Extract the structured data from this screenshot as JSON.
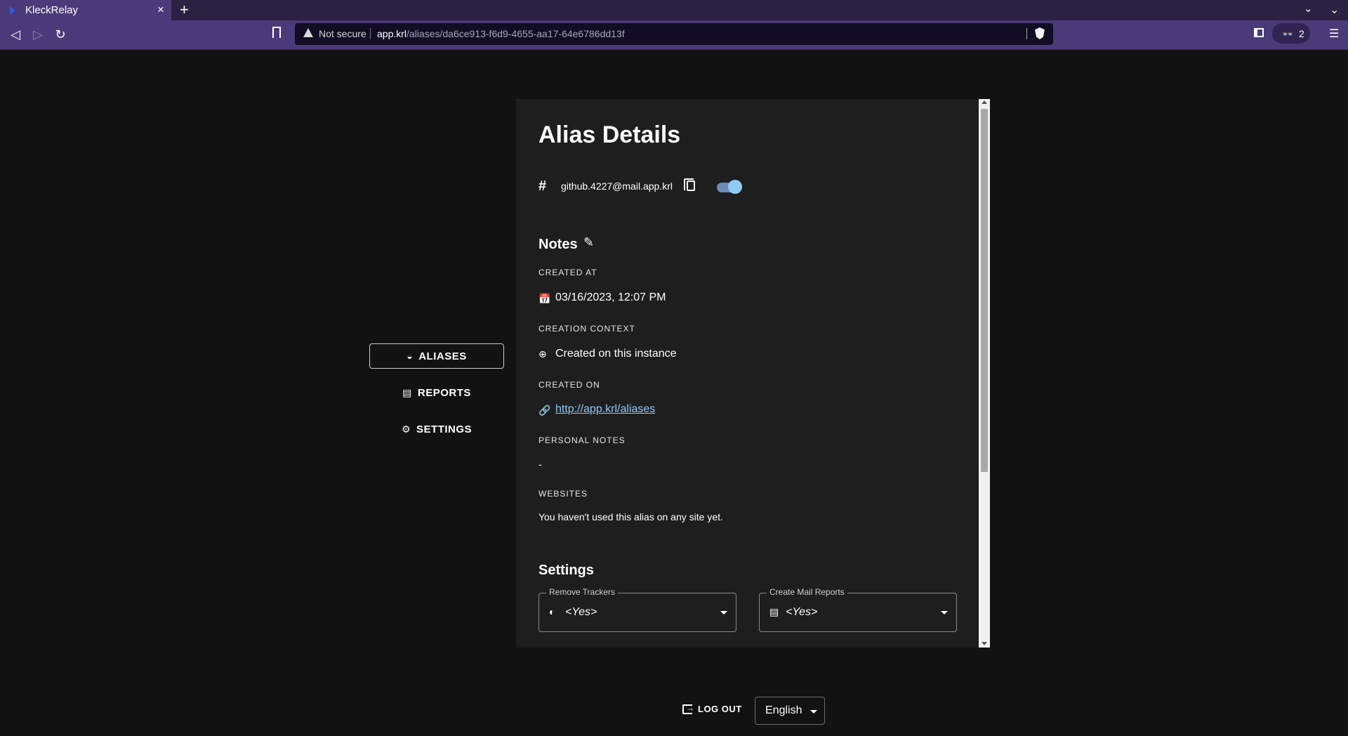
{
  "browser": {
    "tab_title": "KleckRelay",
    "tab_close": "×",
    "new_tab": "+",
    "tab_list": "⌄",
    "minimize": "⌄",
    "back": "◁",
    "forward": "▷",
    "reload": "↻",
    "not_secure": "Not secure",
    "url_host": "app.krl",
    "url_path": "/aliases/da6ce913-f6d9-4655-aa17-64e6786dd13f",
    "ext_icon": "👓",
    "ext_count": "2",
    "menu": "☰"
  },
  "sidebar": {
    "items": [
      {
        "label": "ALIASES",
        "icon": "mask-icon",
        "glyph": "◒",
        "active": true
      },
      {
        "label": "REPORTS",
        "icon": "document-icon",
        "glyph": "▤",
        "active": false
      },
      {
        "label": "SETTINGS",
        "icon": "gear-icon",
        "glyph": "⚙",
        "active": false
      }
    ]
  },
  "alias": {
    "title": "Alias Details",
    "hash": "#",
    "address": "github.4227@mail.app.krl",
    "enabled": true
  },
  "notes": {
    "title": "Notes",
    "edit_glyph": "✎",
    "created_at_label": "CREATED AT",
    "created_at_value": "03/16/2023, 12:07 PM",
    "created_at_glyph": "📅",
    "creation_context_label": "CREATION CONTEXT",
    "creation_context_value": "Created on this instance",
    "creation_context_glyph": "⊕",
    "created_on_label": "CREATED ON",
    "created_on_value": "http://app.krl/aliases",
    "created_on_glyph": "🔗",
    "personal_notes_label": "PERSONAL NOTES",
    "personal_notes_value": "-",
    "websites_label": "WEBSITES",
    "websites_value": "You haven't used this alias on any site yet."
  },
  "settings": {
    "title": "Settings",
    "remove_trackers": {
      "label": "Remove Trackers",
      "value": "<Yes>",
      "glyph": "◐"
    },
    "create_mail_reports": {
      "label": "Create Mail Reports",
      "value": "<Yes>",
      "glyph": "▤"
    }
  },
  "footer": {
    "logout_label": "LOG OUT",
    "language": "English"
  },
  "colors": {
    "background": "#121212",
    "card": "#1e1e1e",
    "accent": "#90caf9",
    "browser_chrome": "#4a3a7a"
  }
}
